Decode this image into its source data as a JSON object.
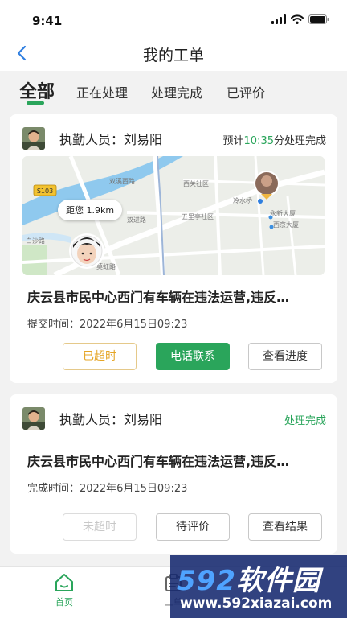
{
  "status_bar": {
    "time": "9:41"
  },
  "nav": {
    "title": "我的工单"
  },
  "tabs": [
    {
      "label": "全部",
      "active": true
    },
    {
      "label": "正在处理",
      "active": false
    },
    {
      "label": "处理完成",
      "active": false
    },
    {
      "label": "已评价",
      "active": false
    }
  ],
  "orders": [
    {
      "officer_label": "执勤人员：刘易阳",
      "eta_prefix": "预计",
      "eta_value": "10:35",
      "eta_suffix": "分处理完成",
      "map": {
        "distance": "距您 1.9km",
        "road_badge": "S103",
        "labels": [
          "双溪西路",
          "西关社区",
          "冷水桥",
          "永新大厦",
          "西京大厦",
          "五里亭社区",
          "双进路",
          "白沙路",
          "莫虹路"
        ]
      },
      "title": "庆云县市民中心西门有车辆在违法运营,违反…",
      "time_label": "提交时间：",
      "time_value": "2022年6月15日09:23",
      "buttons": [
        "已超时",
        "电话联系",
        "查看进度"
      ]
    },
    {
      "officer_label": "执勤人员：刘易阳",
      "state": "处理完成",
      "title": "庆云县市民中心西门有车辆在违法运营,违反…",
      "time_label": "完成时间：",
      "time_value": "2022年6月15日09:23",
      "buttons": [
        "未超时",
        "待评价",
        "查看结果"
      ]
    }
  ],
  "bottom_tabs": [
    {
      "label": "首页",
      "icon": "home-icon",
      "active": true
    },
    {
      "label": "工单",
      "icon": "work-order-icon",
      "active": false
    }
  ],
  "watermark": {
    "brand_num": "592",
    "brand_text": "软件园",
    "url": "www.592xiazai.com"
  },
  "colors": {
    "accent": "#2aa55b",
    "warning": "#e5a526",
    "watermark": "#14286e"
  }
}
